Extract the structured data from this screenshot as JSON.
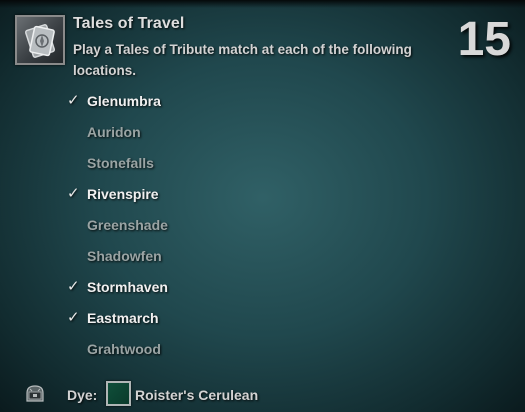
{
  "achievement": {
    "icon": "tribute-card-icon",
    "title": "Tales of Travel",
    "description": "Play a Tales of Tribute match at each of the following locations.",
    "points": "15"
  },
  "locations": [
    {
      "name": "Glenumbra",
      "completed": true
    },
    {
      "name": "Auridon",
      "completed": false
    },
    {
      "name": "Stonefalls",
      "completed": false
    },
    {
      "name": "Rivenspire",
      "completed": true
    },
    {
      "name": "Greenshade",
      "completed": false
    },
    {
      "name": "Shadowfen",
      "completed": false
    },
    {
      "name": "Stormhaven",
      "completed": true
    },
    {
      "name": "Eastmarch",
      "completed": true
    },
    {
      "name": "Grahtwood",
      "completed": false
    }
  ],
  "reward": {
    "icon": "dye-reward-icon",
    "label": "Dye:",
    "dye_name": "Roister's Cerulean",
    "dye_color": "#0f4f3a"
  },
  "colors": {
    "completed_text": "#f0f0f0",
    "incomplete_text": "#9aa4a4",
    "panel_teal": "#32646a"
  }
}
